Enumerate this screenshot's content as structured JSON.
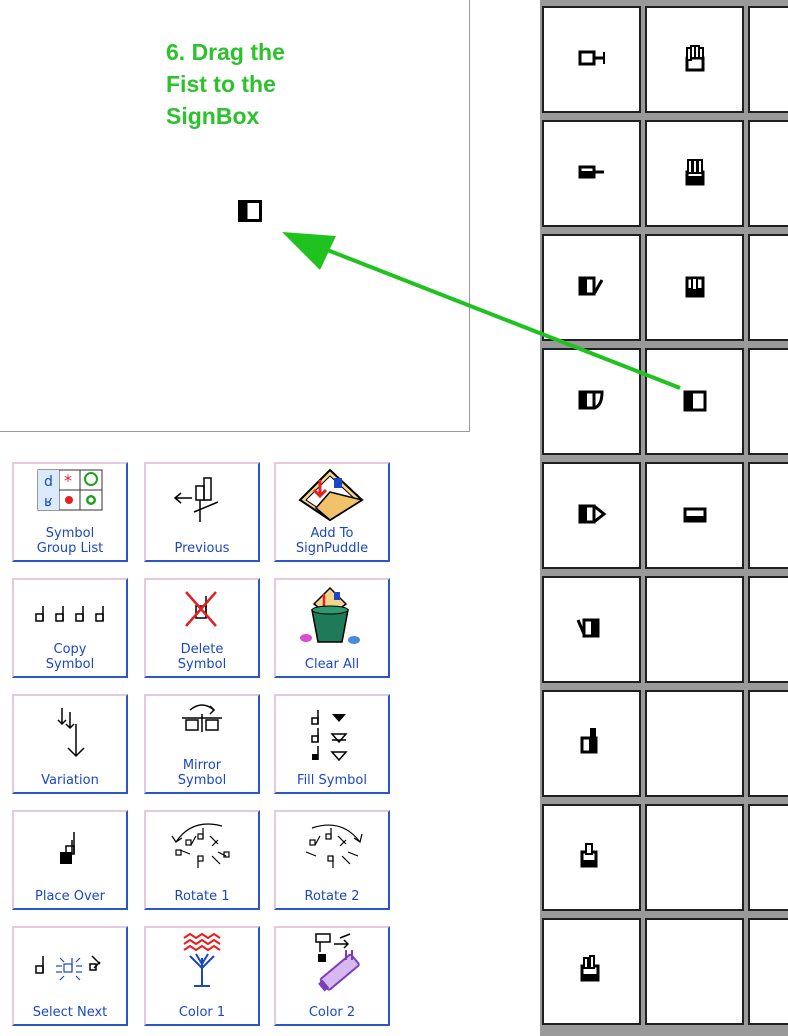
{
  "signbox": {
    "instruction": "6. Drag the\nFist to the\nSignBox",
    "instruction_color": "#2cc22c",
    "placed_symbol": "fist-square-half-filled"
  },
  "arrow": {
    "color": "#1fc21f",
    "meaning": "drag-from-palette-to-signbox"
  },
  "tools": [
    {
      "label": "Symbol\nGroup List",
      "icon": "symbol-group-list-icon"
    },
    {
      "label": "Previous",
      "icon": "previous-icon"
    },
    {
      "label": "Add To\nSignPuddle",
      "icon": "add-to-signpuddle-icon"
    },
    {
      "label": "Copy\nSymbol",
      "icon": "copy-symbol-icon"
    },
    {
      "label": "Delete\nSymbol",
      "icon": "delete-symbol-icon"
    },
    {
      "label": "Clear All",
      "icon": "clear-all-icon"
    },
    {
      "label": "Variation",
      "icon": "variation-icon"
    },
    {
      "label": "Mirror\nSymbol",
      "icon": "mirror-symbol-icon"
    },
    {
      "label": "Fill Symbol",
      "icon": "fill-symbol-icon"
    },
    {
      "label": "Place Over",
      "icon": "place-over-icon"
    },
    {
      "label": "Rotate 1",
      "icon": "rotate-1-icon"
    },
    {
      "label": "Rotate 2",
      "icon": "rotate-2-icon"
    },
    {
      "label": "Select Next",
      "icon": "select-next-icon"
    },
    {
      "label": "Color 1",
      "icon": "color-1-icon"
    },
    {
      "label": "Color 2",
      "icon": "color-2-icon"
    }
  ],
  "palette": {
    "columns": [
      [
        "hand-square-tail",
        "hand-square-bar-tail",
        "hand-square-diagonal",
        "hand-square-curve",
        "hand-square-triangle",
        "hand-square-back",
        "hand-thumb-up",
        "hand-thumb-index",
        "hand-thumb-fingers"
      ],
      [
        "fist-fingers-4",
        "fist-fingers-3",
        "fist-index",
        "fist-square-half-filled",
        "fist-bar",
        "",
        "",
        "",
        ""
      ],
      [
        "",
        "",
        "",
        "",
        "",
        "",
        "",
        "",
        ""
      ]
    ],
    "highlight_cell": "fist-square-half-filled"
  },
  "colors": {
    "button_text": "#1b47c4",
    "button_border_dark": "#2b56c9",
    "button_border_light": "#e6c8e0",
    "grid_line": "#202020"
  }
}
